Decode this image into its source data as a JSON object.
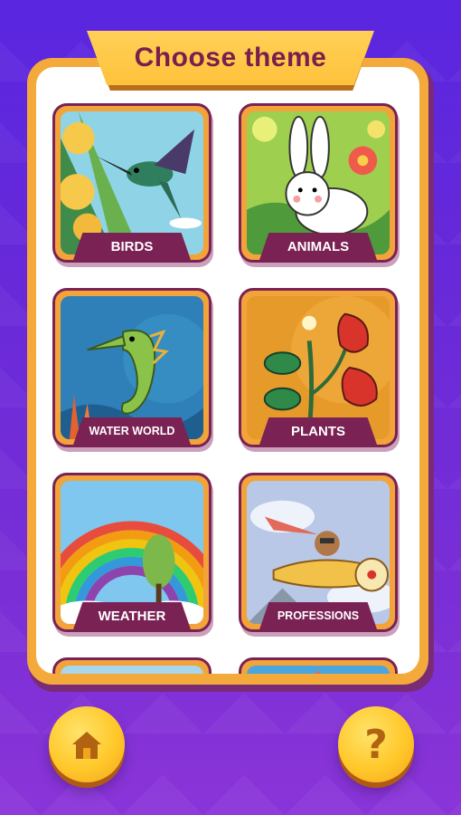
{
  "header": {
    "title": "Choose theme"
  },
  "themes": [
    {
      "label": "BIRDS"
    },
    {
      "label": "ANIMALS"
    },
    {
      "label": "WATER WORLD"
    },
    {
      "label": "PLANTS"
    },
    {
      "label": "WEATHER"
    },
    {
      "label": "PROFESSIONS"
    },
    {
      "label": ""
    },
    {
      "label": ""
    }
  ],
  "footer": {
    "home_icon": "home-icon",
    "help_icon": "help-icon",
    "help_glyph": "?"
  },
  "colors": {
    "background": "#6a2ad8",
    "panel_border": "#f4a93b",
    "label_bg": "#7a2254",
    "title_text": "#7a1f4d",
    "button": "#ffc82a"
  }
}
